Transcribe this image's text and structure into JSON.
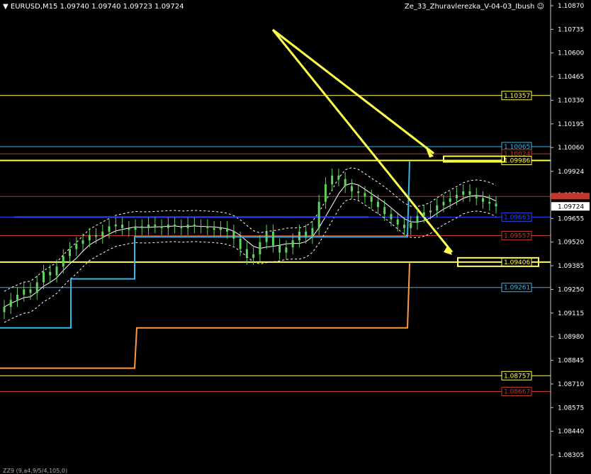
{
  "header": {
    "symbol": "EURUSD,M15",
    "ohlc": "1.09740 1.09740 1.09723 1.09724",
    "indicator": "Ze_33_Zhuravlerezka_V-04-03_Ibush"
  },
  "footer_note": "ZZ9 (9,a4,9/5/4,105,0)",
  "colors": {
    "background": "#000000",
    "candle": "#5fd35f",
    "axis": "#c8c8c8",
    "yellow": "#ffff4d",
    "red": "#c0392b",
    "cyan": "#35b7e8",
    "orange": "#ff9a3c",
    "blue": "#2a45ff",
    "white": "#ffffff"
  },
  "chart_data": {
    "type": "candlestick",
    "symbol": "EURUSD",
    "timeframe": "M15",
    "ylim": [
      1.0822,
      1.0887
    ],
    "price_axis_ticks": [
      "1.10870",
      "1.10735",
      "1.10600",
      "1.10465",
      "1.10330",
      "1.10195",
      "1.10060",
      "1.09924",
      "1.09790",
      "1.09655",
      "1.09520",
      "1.09385",
      "1.09250",
      "1.09115",
      "1.08980",
      "1.08845",
      "1.08710",
      "1.08575",
      "1.08440",
      "1.08305"
    ],
    "current_price": "1.09724",
    "close": [
      1.0915,
      1.0919,
      1.0922,
      1.0925,
      1.0923,
      1.0929,
      1.0935,
      1.0933,
      1.0938,
      1.0944,
      1.0948,
      1.0951,
      1.0953,
      1.0956,
      1.0955,
      1.0958,
      1.0961,
      1.0962,
      1.096,
      1.0959,
      1.0961,
      1.096,
      1.0962,
      1.0961,
      1.096,
      1.0962,
      1.0961,
      1.096,
      1.0962,
      1.0961,
      1.0961,
      1.096,
      1.0959,
      1.096,
      1.0958,
      1.0954,
      1.0948,
      1.0943,
      1.0945,
      1.0952,
      1.0958,
      1.095,
      1.0946,
      1.0949,
      1.0953,
      1.0958,
      1.0955,
      1.096,
      1.0975,
      1.0985,
      1.099,
      1.0988,
      1.0984,
      1.0981,
      1.098,
      1.0978,
      1.0975,
      1.0972,
      1.0968,
      1.0965,
      1.0962,
      1.096,
      1.0963,
      1.0967,
      1.0969,
      1.097,
      1.0973,
      1.0975,
      1.0977,
      1.0979,
      1.0981,
      1.0979,
      1.0977,
      1.0975,
      1.0974,
      1.09724
    ],
    "levels": [
      {
        "price": "1.10357",
        "color": "#ffff4d",
        "label": "1.10357"
      },
      {
        "price": "1.10065",
        "color": "#35b7e8",
        "label": "1.10065"
      },
      {
        "price": "1.10024",
        "color": "#c0392b",
        "label": "1.10024"
      },
      {
        "price": "1.09986",
        "color": "#ffff4d",
        "label": "1.09986"
      },
      {
        "price": "1.09663",
        "color": "#2a45ff",
        "label": "1.09663"
      },
      {
        "price": "1.09557",
        "color": "#c0392b",
        "label": "1.09557"
      },
      {
        "price": "1.09406",
        "color": "#ffff4d",
        "label": "1.09406"
      },
      {
        "price": "1.09261",
        "color": "#35b7e8",
        "label": "1.09261"
      },
      {
        "price": "1.08757",
        "color": "#ffff4d",
        "label": "1.08757"
      },
      {
        "price": "1.08667",
        "color": "#c0392b",
        "label": "1.08667"
      }
    ]
  }
}
